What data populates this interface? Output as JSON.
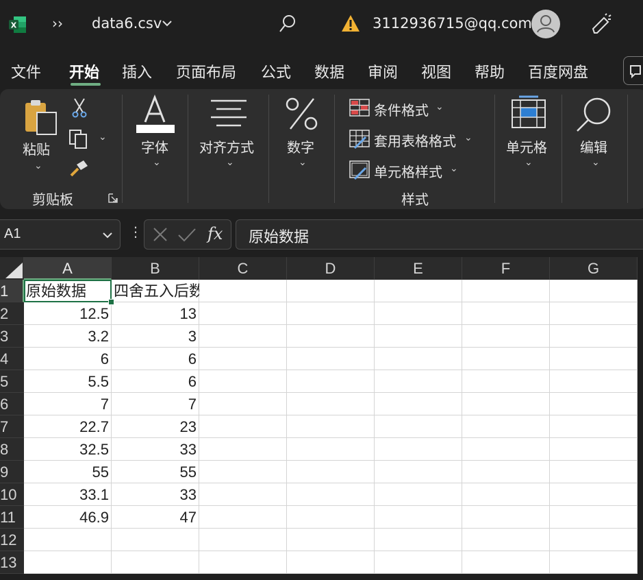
{
  "titlebar": {
    "app_icon": "excel-icon",
    "more_label": "››",
    "filename": "data6.csv",
    "account": "3112936715@qq.com"
  },
  "menu": {
    "tabs": [
      {
        "label": "文件"
      },
      {
        "label": "开始"
      },
      {
        "label": "插入"
      },
      {
        "label": "页面布局"
      },
      {
        "label": "公式"
      },
      {
        "label": "数据"
      },
      {
        "label": "审阅"
      },
      {
        "label": "视图"
      },
      {
        "label": "帮助"
      },
      {
        "label": "百度网盘"
      }
    ],
    "active_tab": "开始"
  },
  "ribbon": {
    "paste": "粘贴",
    "clipboard": "剪贴板",
    "font": "字体",
    "align": "对齐方式",
    "number": "数字",
    "conditional": "条件格式",
    "table_format": "套用表格格式",
    "cell_style": "单元格样式",
    "styles_group": "样式",
    "cells": "单元格",
    "editing": "编辑"
  },
  "formula_bar": {
    "name_box": "A1",
    "content": "原始数据",
    "fx": "fx"
  },
  "sheet": {
    "columns": [
      "A",
      "B",
      "C",
      "D",
      "E",
      "F",
      "G"
    ],
    "rows": [
      "1",
      "2",
      "3",
      "4",
      "5",
      "6",
      "7",
      "8",
      "9",
      "10",
      "11",
      "12",
      "13"
    ],
    "headers": [
      "原始数据",
      "四舍五入后数据"
    ],
    "data": [
      [
        "12.5",
        "13"
      ],
      [
        "3.2",
        "3"
      ],
      [
        "6",
        "6"
      ],
      [
        "5.5",
        "6"
      ],
      [
        "7",
        "7"
      ],
      [
        "22.7",
        "23"
      ],
      [
        "32.5",
        "33"
      ],
      [
        "55",
        "55"
      ],
      [
        "33.1",
        "33"
      ],
      [
        "46.9",
        "47"
      ]
    ]
  },
  "colors": {
    "accent": "#6fae83",
    "excel_green": "#1d6f42",
    "warning": "#f2b233"
  }
}
